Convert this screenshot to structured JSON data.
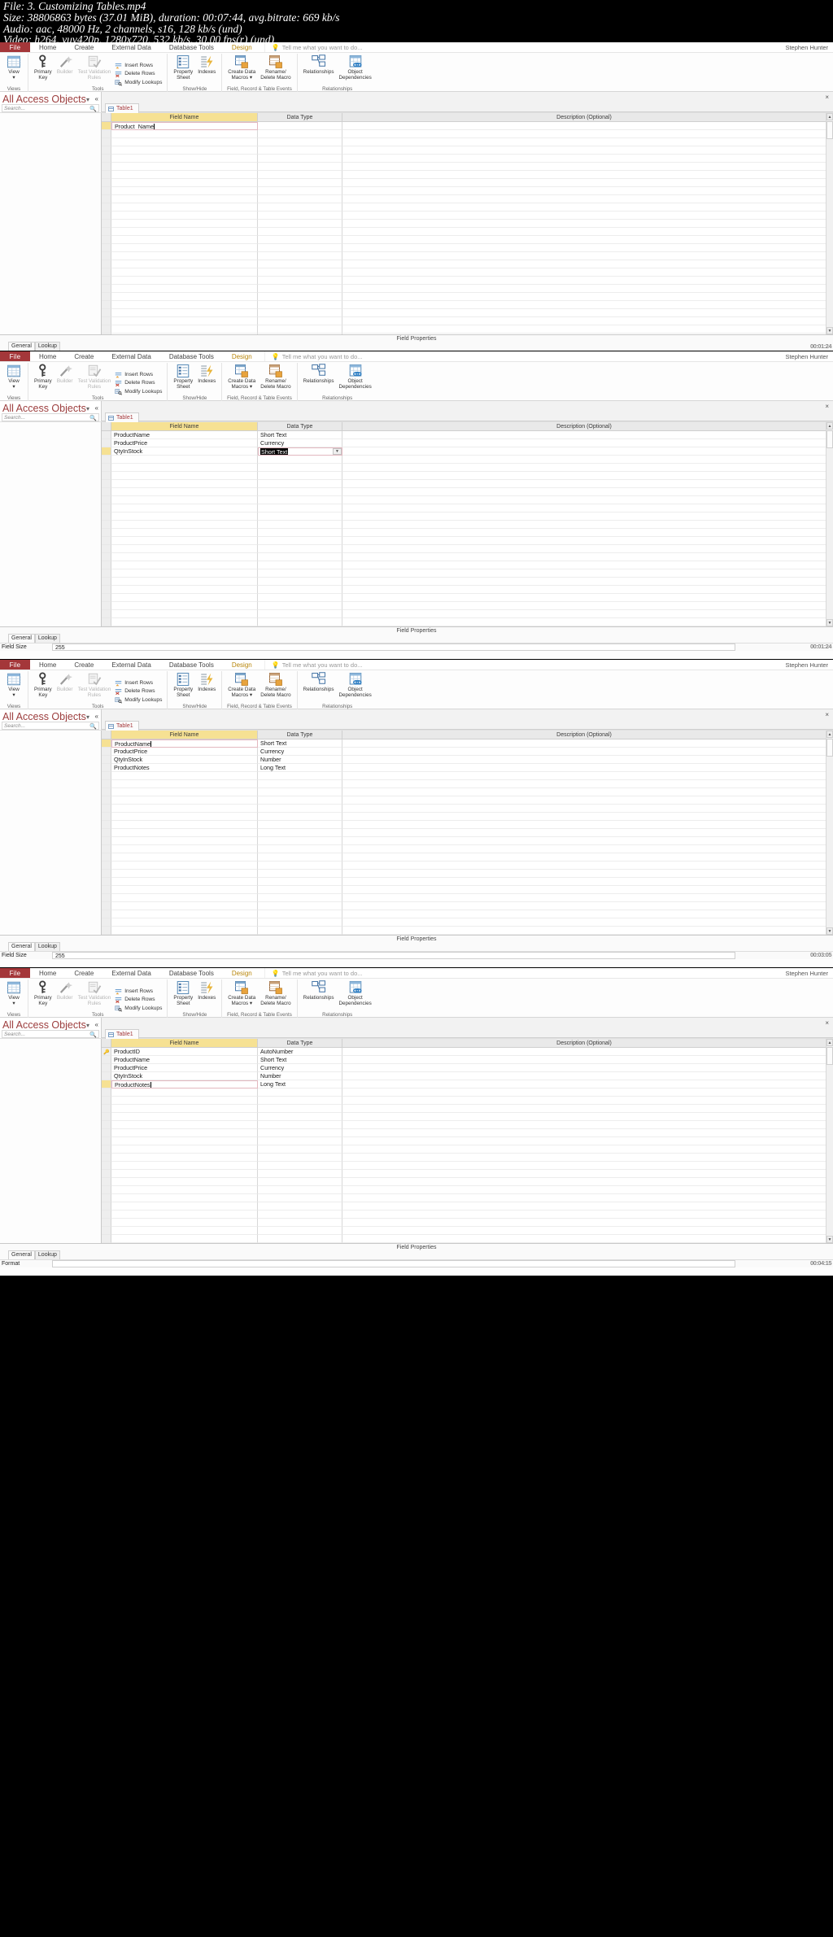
{
  "mediainfo": {
    "line1": "File: 3. Customizing Tables.mp4",
    "line2": "Size: 38806863 bytes (37.01 MiB), duration: 00:07:44, avg.bitrate: 669 kb/s",
    "line3": "Audio: aac, 48000 Hz, 2 channels, s16, 128 kb/s (und)",
    "line4": "Video: h264, yuv420p, 1280x720, 532 kb/s, 30.00 fps(r) (und)"
  },
  "app": {
    "file_tab": "File",
    "tabs": [
      "Home",
      "Create",
      "External Data",
      "Database Tools"
    ],
    "context_tab": "Design",
    "tellme_placeholder": "Tell me what you want to do...",
    "user": "Stephen Hunter",
    "nav_title": "All Access Objects",
    "search_placeholder": "Search...",
    "doc_tab": "Table1",
    "close_label": "×"
  },
  "ribbon": {
    "groups": [
      {
        "label": "Views",
        "items": [
          {
            "name": "view",
            "label": "View",
            "sublabel": "▾",
            "icon": "table-view-icon",
            "dim": false
          }
        ]
      },
      {
        "label": "Tools",
        "items": [
          {
            "name": "primary-key",
            "label": "Primary",
            "sublabel": "Key",
            "icon": "key-icon",
            "dim": false
          },
          {
            "name": "builder",
            "label": "Builder",
            "sublabel": "",
            "icon": "wand-icon",
            "dim": true
          },
          {
            "name": "test-validation-rules",
            "label": "Test Validation",
            "sublabel": "Rules",
            "icon": "check-rules-icon",
            "dim": true
          }
        ],
        "small": [
          {
            "name": "insert-rows",
            "label": "Insert Rows",
            "icon": "insert-rows-icon"
          },
          {
            "name": "delete-rows",
            "label": "Delete Rows",
            "icon": "delete-rows-icon"
          },
          {
            "name": "modify-lookups",
            "label": "Modify Lookups",
            "icon": "modify-lookups-icon"
          }
        ]
      },
      {
        "label": "Show/Hide",
        "items": [
          {
            "name": "property-sheet",
            "label": "Property",
            "sublabel": "Sheet",
            "icon": "property-sheet-icon",
            "dim": false
          },
          {
            "name": "indexes",
            "label": "Indexes",
            "sublabel": "",
            "icon": "indexes-icon",
            "dim": false
          }
        ]
      },
      {
        "label": "Field, Record & Table Events",
        "items": [
          {
            "name": "create-data-macros",
            "label": "Create Data",
            "sublabel": "Macros ▾",
            "icon": "create-data-macro-icon",
            "dim": false
          },
          {
            "name": "rename-delete-macro",
            "label": "Rename/",
            "sublabel": "Delete Macro",
            "icon": "rename-delete-macro-icon",
            "dim": false
          }
        ]
      },
      {
        "label": "Relationships",
        "items": [
          {
            "name": "relationships",
            "label": "Relationships",
            "sublabel": "",
            "icon": "relationships-icon",
            "dim": false
          },
          {
            "name": "object-dependencies",
            "label": "Object",
            "sublabel": "Dependencies",
            "icon": "object-dependencies-icon",
            "dim": false
          }
        ]
      }
    ]
  },
  "grid": {
    "headers": {
      "field_name": "Field Name",
      "data_type": "Data Type",
      "description": "Description (Optional)"
    }
  },
  "field_properties": {
    "title": "Field Properties",
    "tabs": [
      "General",
      "Lookup"
    ],
    "active_tab": "General"
  },
  "windows": [
    {
      "id": "win1",
      "rows": [
        {
          "name": "Product_Name",
          "type": "",
          "selected": true,
          "editing_name": true,
          "key": false
        }
      ],
      "empty_rows": 26,
      "props": [],
      "timestamp": "00:01:24"
    },
    {
      "id": "win2",
      "rows": [
        {
          "name": "ProductName",
          "type": "Short Text",
          "selected": false,
          "key": false
        },
        {
          "name": "ProductPrice",
          "type": "Currency",
          "selected": false,
          "key": false
        },
        {
          "name": "QtyInStock",
          "type": "Short Text",
          "selected": true,
          "editing_type": true,
          "key": false
        }
      ],
      "empty_rows": 24,
      "props": [
        {
          "key": "Field Size",
          "value": "255"
        }
      ],
      "timestamp": "00:01:24"
    },
    {
      "id": "win3",
      "rows": [
        {
          "name": "ProductName",
          "type": "Short Text",
          "selected": true,
          "editing_name": true,
          "key": false
        },
        {
          "name": "ProductPrice",
          "type": "Currency",
          "selected": false,
          "key": false
        },
        {
          "name": "QtyInStock",
          "type": "Number",
          "selected": false,
          "key": false
        },
        {
          "name": "ProductNotes",
          "type": "Long Text",
          "selected": false,
          "key": false
        }
      ],
      "empty_rows": 23,
      "props": [
        {
          "key": "Field Size",
          "value": "255"
        }
      ],
      "timestamp": "00:03:05"
    },
    {
      "id": "win4",
      "rows": [
        {
          "name": "ProductID",
          "type": "AutoNumber",
          "selected": false,
          "key": true
        },
        {
          "name": "ProductName",
          "type": "Short Text",
          "selected": false,
          "key": false
        },
        {
          "name": "ProductPrice",
          "type": "Currency",
          "selected": false,
          "key": false
        },
        {
          "name": "QtyInStock",
          "type": "Number",
          "selected": false,
          "key": false
        },
        {
          "name": "ProductNotes",
          "type": "Long Text",
          "selected": true,
          "editing_name": true,
          "key": false
        }
      ],
      "empty_rows": 22,
      "props": [
        {
          "key": "Format",
          "value": ""
        }
      ],
      "timestamp": "00:04:15"
    }
  ]
}
